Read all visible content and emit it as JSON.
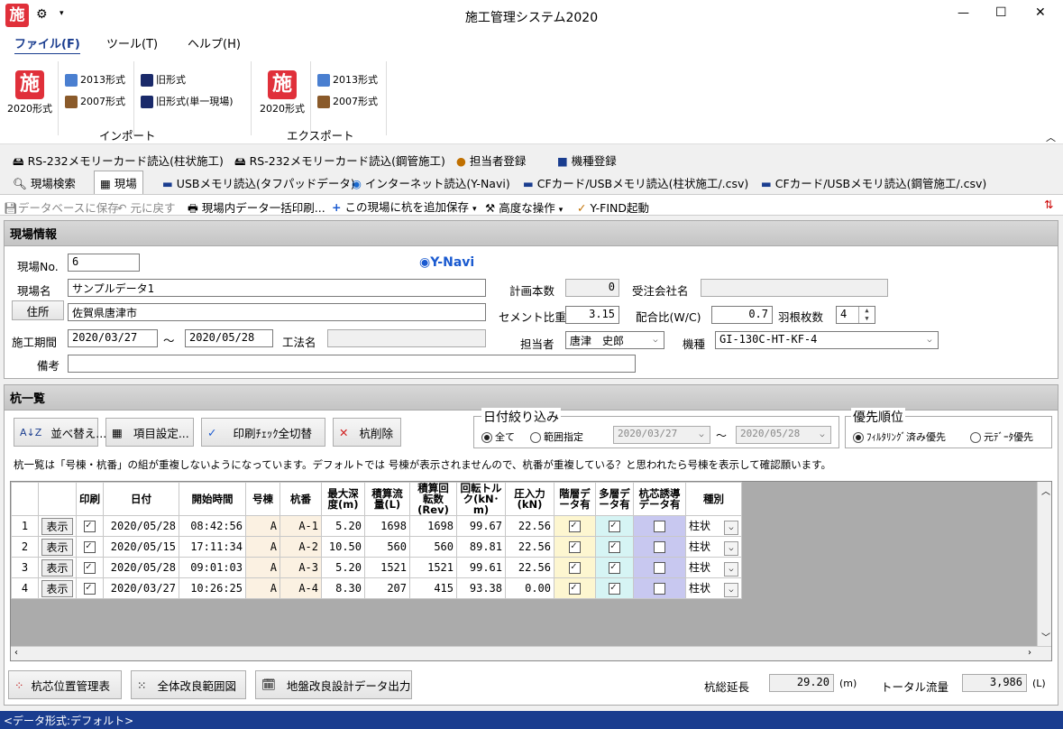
{
  "window": {
    "title": "施工管理システム2020",
    "app_icon": "施",
    "min": "—",
    "max": "☐",
    "close": "✕"
  },
  "ribbon_tabs": [
    "ファイル(F)",
    "ツール(T)",
    "ヘルプ(H)"
  ],
  "ribbon": {
    "import": {
      "group": "インポート",
      "big": "2020形式",
      "items": [
        "2013形式",
        "2007形式",
        "旧形式",
        "旧形式(単一現場)"
      ]
    },
    "export": {
      "group": "エクスポート",
      "big": "2020形式",
      "items": [
        "2013形式",
        "2007形式"
      ]
    }
  },
  "toolbar1": [
    "RS-232メモリーカード読込(柱状施工)",
    "RS-232メモリーカード読込(鋼管施工)",
    "担当者登録",
    "機種登録"
  ],
  "doc_tabs": [
    "現場検索",
    "現場",
    "USBメモリ読込(タフパッドデータ)",
    "インターネット読込(Y-Navi)",
    "CFカード/USBメモリ読込(柱状施工/.csv)",
    "CFカード/USBメモリ読込(鋼管施工/.csv)"
  ],
  "toolbar2": [
    "データベースに保存",
    "元に戻す",
    "現場内データ一括印刷...",
    "この現場に杭を追加保存",
    "高度な操作",
    "Y-FIND起動"
  ],
  "site": {
    "header": "現場情報",
    "logo": "Y-Navi",
    "no_label": "現場No.",
    "no": "6",
    "name_label": "現場名",
    "name": "サンプルデータ1",
    "address_btn": "住所",
    "address": "佐賀県唐津市",
    "period_label": "施工期間",
    "start": "2020/03/27",
    "tilde": "〜",
    "end": "2020/05/28",
    "method_label": "工法名",
    "method": "",
    "note_label": "備考",
    "note": "",
    "plan_label": "計画本数",
    "plan": "0",
    "client_label": "受注会社名",
    "client": "",
    "cement_label": "セメント比重",
    "cement": "3.15",
    "wc_label": "配合比(W/C)",
    "wc": "0.7",
    "blades_label": "羽根枚数",
    "blades": "4",
    "person_label": "担当者",
    "person": "唐津　史郎",
    "model_label": "機種",
    "model": "GI-130C-HT-KF-4"
  },
  "pile": {
    "header": "杭一覧",
    "buttons": [
      "並べ替え...",
      "項目設定...",
      "印刷ﾁｪｯｸ全切替",
      "杭削除"
    ],
    "date_filter": {
      "title": "日付絞り込み",
      "all": "全て",
      "range": "範囲指定",
      "from": "2020/03/27",
      "to": "2020/05/28"
    },
    "priority": {
      "title": "優先順位",
      "a": "ﾌｨﾙﾀﾘﾝｸﾞ済み優先",
      "b": "元ﾃﾞｰﾀ優先"
    },
    "note": "杭一覧は「号棟・杭番」の組が重複しないようになっています。デフォルトでは 号棟が表示されませんので、杭番が重複している？と思われたら号棟を表示して確認願います。",
    "columns": [
      "印刷",
      "日付",
      "開始時間",
      "号棟",
      "杭番",
      "最大深度(m)",
      "積算流量(L)",
      "積算回転数(Rev)",
      "回転トルク(kN･m)",
      "圧入力(kN)",
      "階層データ有",
      "多層データ有",
      "杭芯誘導データ有",
      "種別"
    ],
    "show_label": "表示",
    "rows": [
      {
        "n": "1",
        "print": true,
        "date": "2020/05/28",
        "time": "08:42:56",
        "bldg": "A",
        "pile": "A-1",
        "depth": "5.20",
        "flow": "1698",
        "rev": "1698",
        "torque": "99.67",
        "press": "22.56",
        "layer": true,
        "multi": true,
        "guide": false,
        "kind": "柱状"
      },
      {
        "n": "2",
        "print": true,
        "date": "2020/05/15",
        "time": "17:11:34",
        "bldg": "A",
        "pile": "A-2",
        "depth": "10.50",
        "flow": "560",
        "rev": "560",
        "torque": "89.81",
        "press": "22.56",
        "layer": true,
        "multi": true,
        "guide": false,
        "kind": "柱状"
      },
      {
        "n": "3",
        "print": true,
        "date": "2020/05/28",
        "time": "09:01:03",
        "bldg": "A",
        "pile": "A-3",
        "depth": "5.20",
        "flow": "1521",
        "rev": "1521",
        "torque": "99.61",
        "press": "22.56",
        "layer": true,
        "multi": true,
        "guide": false,
        "kind": "柱状"
      },
      {
        "n": "4",
        "print": true,
        "date": "2020/03/27",
        "time": "10:26:25",
        "bldg": "A",
        "pile": "A-4",
        "depth": "8.30",
        "flow": "207",
        "rev": "415",
        "torque": "93.38",
        "press": "0.00",
        "layer": true,
        "multi": true,
        "guide": false,
        "kind": "柱状"
      }
    ]
  },
  "footer": {
    "buttons": [
      "杭芯位置管理表",
      "全体改良範囲図",
      "地盤改良設計データ出力"
    ],
    "total_len_label": "杭総延長",
    "total_len": "29.20",
    "len_unit": "(m)",
    "total_flow_label": "トータル流量",
    "total_flow": "3,986",
    "flow_unit": "(L)"
  },
  "status": "<データ形式:デフォルト>"
}
